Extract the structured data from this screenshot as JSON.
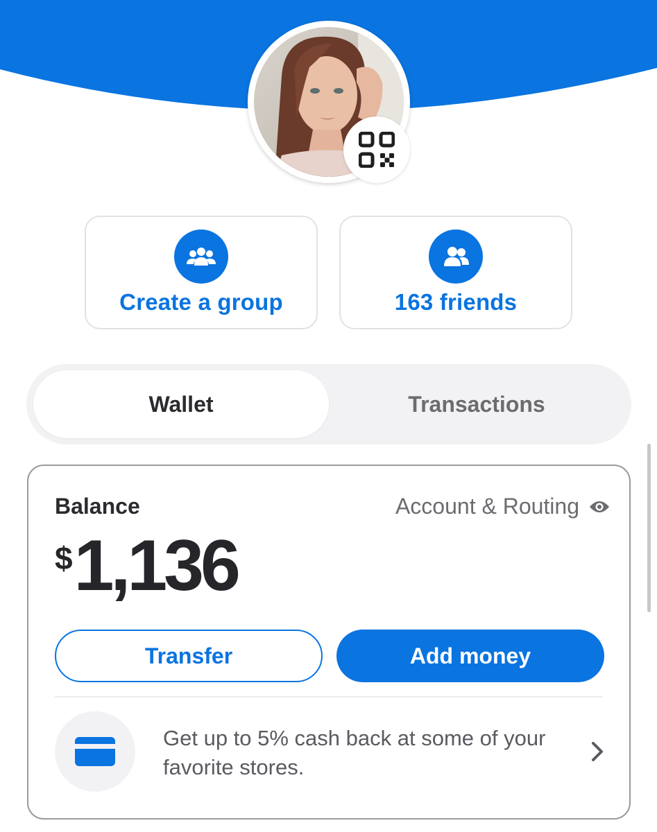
{
  "colors": {
    "accent": "#0a74e0",
    "text": "#2b2b2f",
    "muted": "#6b6b70",
    "surface": "#f2f2f4"
  },
  "profile": {
    "avatar_alt": "profile photo",
    "qr_icon": "qr-code-icon"
  },
  "actions": [
    {
      "label": "Create a group",
      "icon": "group-icon"
    },
    {
      "label": "163 friends",
      "icon": "friends-icon"
    }
  ],
  "tabs": [
    {
      "label": "Wallet",
      "active": true
    },
    {
      "label": "Transactions",
      "active": false
    }
  ],
  "balance": {
    "title": "Balance",
    "account_link": "Account & Routing",
    "account_icon": "eye-icon",
    "currency_symbol": "$",
    "amount": "1,136",
    "transfer_label": "Transfer",
    "add_money_label": "Add money"
  },
  "promo": {
    "icon": "credit-card-icon",
    "text": "Get up to 5% cash back at some of your favorite stores.",
    "chevron": "chevron-right-icon"
  }
}
